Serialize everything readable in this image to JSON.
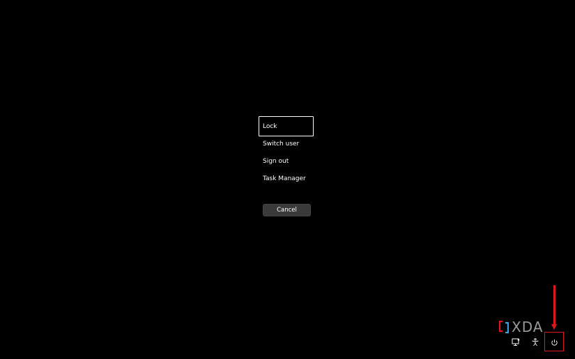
{
  "security_options": {
    "menu_items": [
      {
        "label": "Lock",
        "focused": true
      },
      {
        "label": "Switch user",
        "focused": false
      },
      {
        "label": "Sign out",
        "focused": false
      },
      {
        "label": "Task Manager",
        "focused": false
      }
    ],
    "cancel_label": "Cancel"
  },
  "tray": {
    "network_icon": "network-icon",
    "accessibility_icon": "accessibility-icon",
    "power_icon": "power-icon"
  },
  "annotation": {
    "color": "#e0161d"
  },
  "watermark": {
    "text": "XDA",
    "bracket_colors": [
      "#e0161d",
      "#3aa0e8"
    ]
  }
}
